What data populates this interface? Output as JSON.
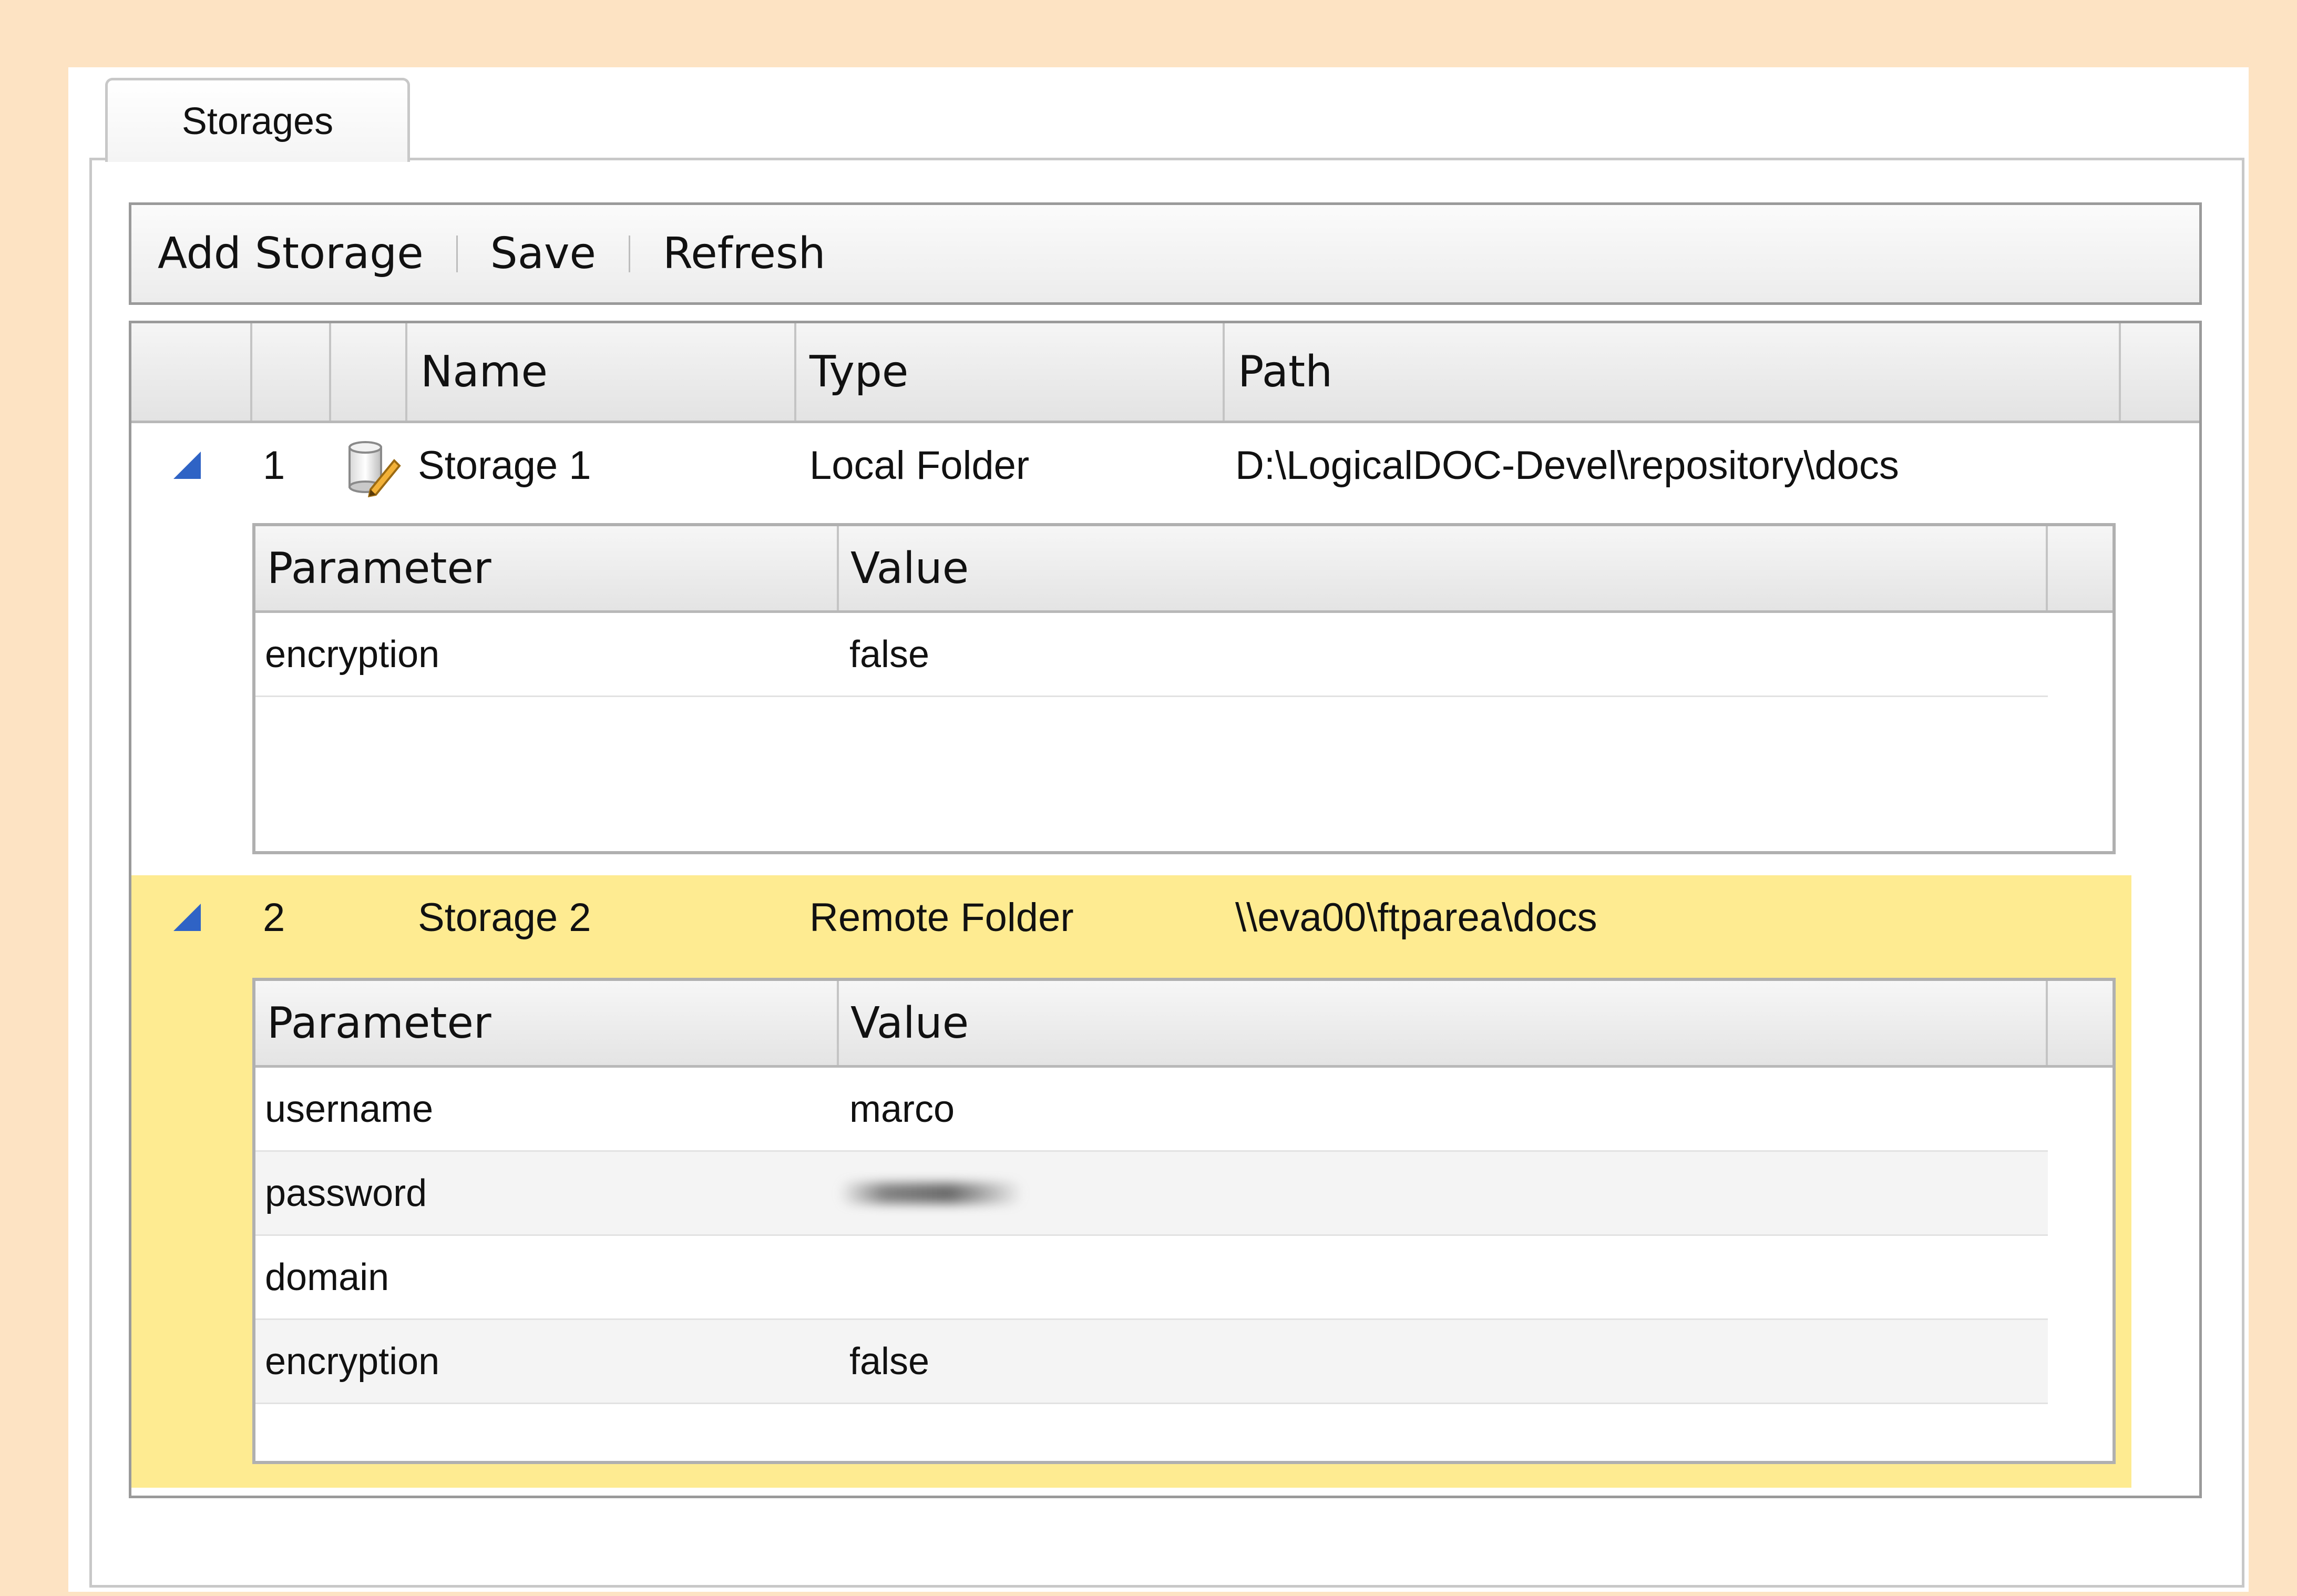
{
  "tab": {
    "label": "Storages"
  },
  "toolbar": {
    "add_label": "Add Storage",
    "save_label": "Save",
    "refresh_label": "Refresh"
  },
  "grid": {
    "columns": {
      "name": "Name",
      "type": "Type",
      "path": "Path"
    },
    "rows": [
      {
        "id": "1",
        "name": "Storage 1",
        "type": "Local Folder",
        "path": "D:\\LogicalDOC-Devel\\repository\\docs",
        "icon": "storage-edit-icon",
        "selected": false,
        "params": {
          "header_param": "Parameter",
          "header_value": "Value",
          "items": [
            {
              "name": "encryption",
              "value": "false"
            }
          ]
        }
      },
      {
        "id": "2",
        "name": "Storage 2",
        "type": "Remote Folder",
        "path": "\\\\eva00\\ftparea\\docs",
        "selected": true,
        "params": {
          "header_param": "Parameter",
          "header_value": "Value",
          "items": [
            {
              "name": "username",
              "value": "marco"
            },
            {
              "name": "password",
              "value": ""
            },
            {
              "name": "domain",
              "value": ""
            },
            {
              "name": "encryption",
              "value": "false"
            }
          ]
        }
      }
    ]
  },
  "colors": {
    "background": "#fde3c3",
    "selected_row": "#feeb91",
    "expander": "#2f63c5"
  }
}
